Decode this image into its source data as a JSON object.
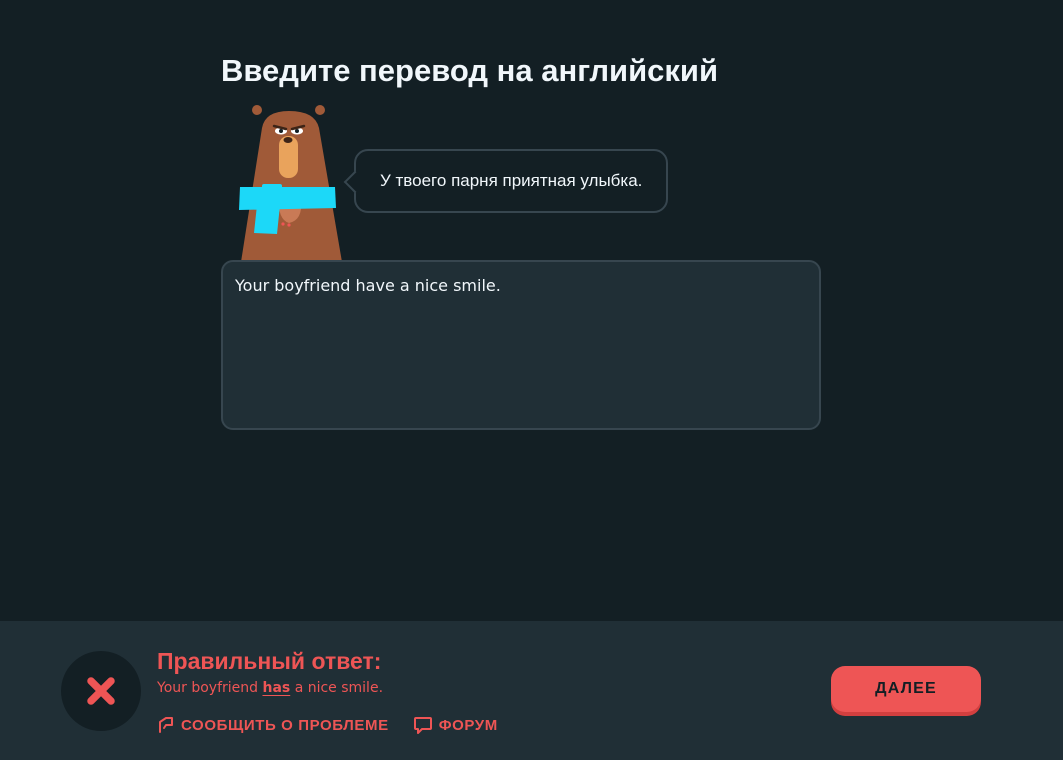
{
  "challenge": {
    "title": "Введите перевод на английский",
    "prompt": "У твоего парня приятная улыбка.",
    "user_answer": "Your boyfriend have a nice smile."
  },
  "feedback": {
    "title": "Правильный ответ:",
    "answer_before": "Your boyfriend",
    "answer_highlight": "has",
    "answer_after": "a nice smile.",
    "report_label": "СООБЩИТЬ О ПРОБЛЕМЕ",
    "forum_label": "ФОРУМ",
    "continue_label": "ДАЛЕЕ",
    "status_icon": "x-mark-icon"
  },
  "colors": {
    "background": "#131f24",
    "footer_background": "#202f36",
    "error": "#ee5555",
    "accent_cyan": "#1cd8f8",
    "bear_brown": "#a05a38"
  }
}
